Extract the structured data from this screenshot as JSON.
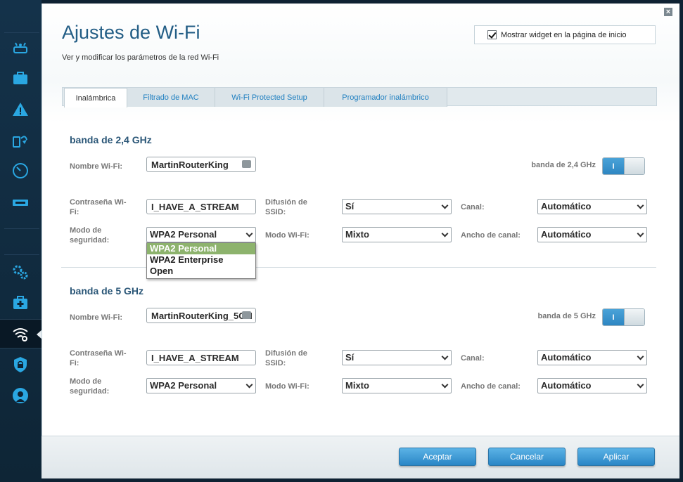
{
  "sidebar": {
    "icons": [
      {
        "name": "router-icon",
        "label": ""
      },
      {
        "name": "devices-icon",
        "label": ""
      },
      {
        "name": "alert-icon",
        "label": ""
      },
      {
        "name": "connectivity-icon",
        "label": ""
      },
      {
        "name": "speed-gauge-icon",
        "label": ""
      },
      {
        "name": "usb-storage-icon",
        "label": ""
      },
      {
        "name": "settings-gears-icon",
        "label": ""
      },
      {
        "name": "troubleshooting-icon",
        "label": ""
      },
      {
        "name": "wifi-settings-icon",
        "label": ""
      },
      {
        "name": "security-lock-icon",
        "label": ""
      },
      {
        "name": "parental-controls-icon",
        "label": ""
      }
    ]
  },
  "header": {
    "title": "Ajustes de Wi-Fi",
    "subtitle": "Ver y modificar los parámetros de la red Wi-Fi",
    "widget_label": "Mostrar widget en la página de inicio",
    "widget_checked": true
  },
  "tabs": [
    {
      "label": "Inalámbrica",
      "active": true
    },
    {
      "label": "Filtrado de MAC",
      "active": false
    },
    {
      "label": "Wi-Fi Protected Setup",
      "active": false
    },
    {
      "label": "Programador inalámbrico",
      "active": false
    }
  ],
  "labels": {
    "wifi_name": "Nombre Wi-Fi:",
    "password_line1": "Contraseña Wi-",
    "password_line2": "Fi:",
    "security_line1": "Modo de",
    "security_line2": "seguridad:",
    "ssid_line1": "Difusión de",
    "ssid_line2": "SSID:",
    "wifi_mode": "Modo Wi-Fi:",
    "channel": "Canal:",
    "channel_width": "Ancho de canal:"
  },
  "band24": {
    "title": "banda de 2,4 GHz",
    "toggle_label": "banda de 2,4 GHz",
    "toggle_state": "I",
    "wifi_name": "MartinRouterKing",
    "password": "I_HAVE_A_STREAM",
    "security_mode": "WPA2 Personal",
    "ssid_broadcast": "Sí",
    "wifi_mode": "Mixto",
    "channel": "Automático",
    "channel_width": "Automático"
  },
  "band5": {
    "title": "banda de 5 GHz",
    "toggle_label": "banda de 5 GHz",
    "toggle_state": "I",
    "wifi_name": "MartinRouterKing_5GH",
    "password": "I_HAVE_A_STREAM",
    "security_mode": "WPA2 Personal",
    "ssid_broadcast": "Sí",
    "wifi_mode": "Mixto",
    "channel": "Automático",
    "channel_width": "Automático"
  },
  "security_dropdown": {
    "options": [
      "WPA2 Personal",
      "WPA2 Enterprise",
      "Open"
    ],
    "highlighted": "WPA2 Personal"
  },
  "footer": {
    "accept": "Aceptar",
    "cancel": "Cancelar",
    "apply": "Aplicar"
  },
  "colors": {
    "accent": "#2a86c6",
    "title": "#225d85",
    "highlight": "#8db36d"
  }
}
